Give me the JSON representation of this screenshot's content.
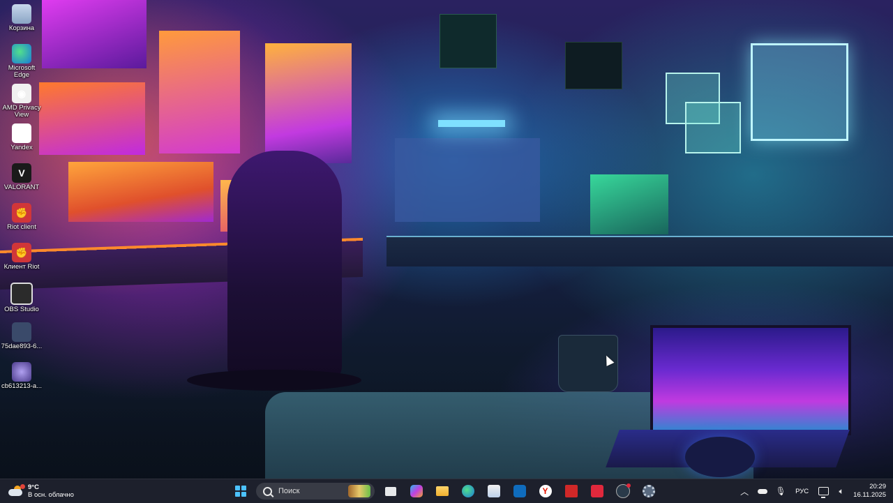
{
  "desktop": {
    "icons": [
      {
        "label": "Корзина",
        "icon": "recycle-bin-icon"
      },
      {
        "label": "Microsoft Edge",
        "icon": "edge-icon"
      },
      {
        "label": "AMD Privacy View",
        "icon": "amd-privacy-view-icon"
      },
      {
        "label": "Yandex",
        "icon": "yandex-icon"
      },
      {
        "label": "VALORANT",
        "icon": "valorant-icon"
      },
      {
        "label": "Riot client",
        "icon": "riot-client-icon"
      },
      {
        "label": "Клиент Riot",
        "icon": "riot-client-icon"
      },
      {
        "label": "OBS Studio",
        "icon": "obs-studio-icon"
      },
      {
        "label": "75dae893-6...",
        "icon": "image-file-icon"
      },
      {
        "label": "cb613213-a...",
        "icon": "image-file-icon"
      }
    ]
  },
  "taskbar": {
    "weather": {
      "temp": "9°C",
      "desc": "В осн. облачно",
      "icon": "partly-cloudy-icon"
    },
    "search_placeholder": "Поиск",
    "apps": [
      {
        "name": "task-view",
        "icon": "task-view-icon"
      },
      {
        "name": "copilot",
        "icon": "copilot-icon"
      },
      {
        "name": "file-explorer",
        "icon": "folder-icon"
      },
      {
        "name": "edge",
        "icon": "edge-icon"
      },
      {
        "name": "microsoft-store",
        "icon": "store-icon"
      },
      {
        "name": "outlook",
        "icon": "mail-icon"
      },
      {
        "name": "yandex",
        "icon": "yandex-icon"
      },
      {
        "name": "amd-software",
        "icon": "amd-icon"
      },
      {
        "name": "vivaldi",
        "icon": "red-app-icon"
      },
      {
        "name": "steam",
        "icon": "steam-icon"
      },
      {
        "name": "settings",
        "icon": "gear-icon"
      }
    ],
    "tray": {
      "lang": "РУС",
      "time": "20:29",
      "date": "16.11.2025"
    }
  },
  "colors": {
    "taskbar_bg": "#1e222c",
    "start_accent": "#4cc2ff"
  }
}
